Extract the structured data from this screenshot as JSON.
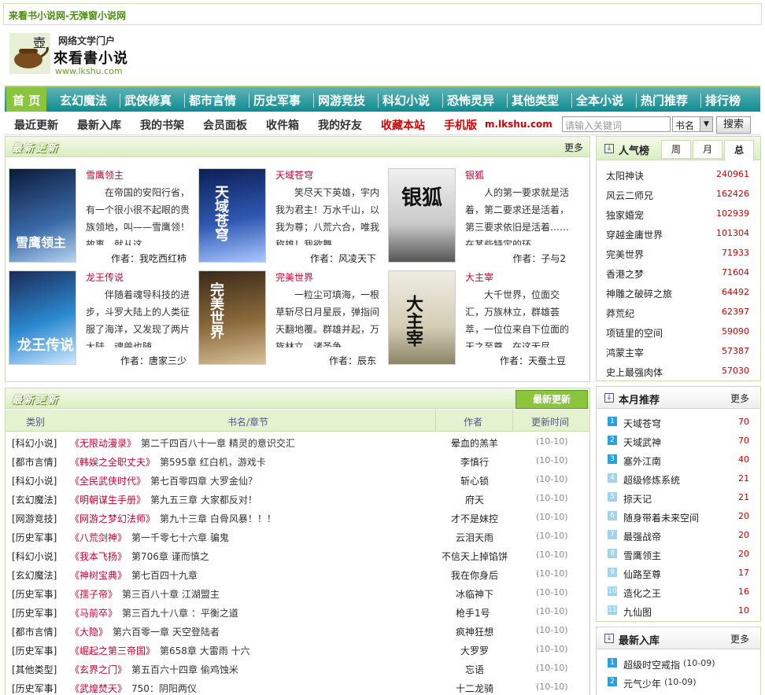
{
  "site_title": "来看书小说网-无弹窗小说网",
  "logo": {
    "tagline": "网络文学门户",
    "name": "來看書小说",
    "url": "www.lkshu.com"
  },
  "main_nav": [
    "首 页",
    "玄幻魔法",
    "武侠修真",
    "都市言情",
    "历史军事",
    "网游竞技",
    "科幻小说",
    "恐怖灵异",
    "其他类型",
    "全本小说",
    "热门推荐",
    "排行榜"
  ],
  "sub_nav": [
    "最近更新",
    "最新入库",
    "我的书架",
    "会员面板",
    "收件箱",
    "我的好友",
    "收藏本站",
    "手机版"
  ],
  "mobile_domain": "m.lkshu.com",
  "search": {
    "placeholder": "请输入关键词",
    "type": "书名",
    "button": "搜索"
  },
  "latest_panel": {
    "title": "最新更新",
    "more": "更多"
  },
  "featured_books": [
    {
      "name": "雪鹰领主",
      "desc": "在帝国的安阳行省，有一个很小很不起眼的贵族领地，叫——雪鹰领！故事，就从这",
      "author": "作者：我吃西红柿",
      "cover_text": "雪鹰领主"
    },
    {
      "name": "天域苍穹",
      "desc": "笑尽天下英雄，宇内我为君主！万水千山，以我为尊；八荒六合，唯我称雄！我欲舞",
      "author": "作者：风凌天下",
      "cover_text": "天域苍穹"
    },
    {
      "name": "银狐",
      "desc": "人的第一要求就是活着，第二要求还是活着，第三要求依旧是活着……在某些特定的环",
      "author": "作者：子与2",
      "cover_text": "银狐"
    },
    {
      "name": "龙王传说",
      "desc": "伴随着魂导科技的进步，斗罗大陆上的人类征服了海洋，又发现了两片大陆。魂兽也随",
      "author": "作者：唐家三少",
      "cover_text": "龙王传说"
    },
    {
      "name": "完美世界",
      "desc": "一粒尘可填海，一根草斩尽日月星辰，弹指间天翻地覆。群雄并起，万族林立，诸圣争",
      "author": "作者：辰东",
      "cover_text": "完美世界"
    },
    {
      "name": "大主宰",
      "desc": "大千世界，位面交汇，万族林立，群雄荟萃，一位位来自下位面的天之至尊，在这无尽",
      "author": "作者：天蚕土豆",
      "cover_text": "大主宰"
    }
  ],
  "update_panel": {
    "title": "最新更新",
    "tab": "最新更新",
    "headers": [
      "类别",
      "书名/章节",
      "作者",
      "更新时间"
    ]
  },
  "update_rows": [
    {
      "cat": "[科幻小说]",
      "book": "《无限动漫录》",
      "chapter": "第二千四百八十一章 精灵的意识交汇",
      "author": "晕血的羔羊",
      "time": "(10-10)"
    },
    {
      "cat": "[都市言情]",
      "book": "《韩娱之全职丈夫》",
      "chapter": "第595章 红白机，游戏卡",
      "author": "李慎行",
      "time": "(10-10)"
    },
    {
      "cat": "[科幻小说]",
      "book": "《全民武侠时代》",
      "chapter": "第七百零四章 大罗金仙？",
      "author": "斩心锁",
      "time": "(10-10)"
    },
    {
      "cat": "[玄幻魔法]",
      "book": "《明朝谋生手册》",
      "chapter": "第九五三章 大家都反对！",
      "author": "府天",
      "time": "(10-10)"
    },
    {
      "cat": "[网游竞技]",
      "book": "《网游之梦幻法师》",
      "chapter": "第九十三章 白骨风暴！！！",
      "author": "才不是妹控",
      "time": "(10-10)"
    },
    {
      "cat": "[历史军事]",
      "book": "《八荒剑神》",
      "chapter": "第一千零七十六章 骗鬼",
      "author": "云泪天雨",
      "time": "(10-10)"
    },
    {
      "cat": "[科幻小说]",
      "book": "《我本飞扬》",
      "chapter": "第706章 谨而慎之",
      "author": "不信天上掉馅饼",
      "time": "(10-10)"
    },
    {
      "cat": "[玄幻魔法]",
      "book": "《神树宝典》",
      "chapter": "第七百四十九章",
      "author": "我在你身后",
      "time": "(10-10)"
    },
    {
      "cat": "[历史军事]",
      "book": "《孺子帝》",
      "chapter": "第三百八十章 江湖盟主",
      "author": "冰临神下",
      "time": "(10-10)"
    },
    {
      "cat": "[历史军事]",
      "book": "《马前卒》",
      "chapter": "第三百九十八章 ：平衡之道",
      "author": "枪手1号",
      "time": "(10-10)"
    },
    {
      "cat": "[都市言情]",
      "book": "《大隐》",
      "chapter": "第六百零一章 天空登陆者",
      "author": "疯神狂想",
      "time": "(10-10)"
    },
    {
      "cat": "[历史军事]",
      "book": "《崛起之第三帝国》",
      "chapter": "第658章 大雷雨 十六",
      "author": "大罗罗",
      "time": "(10-10)"
    },
    {
      "cat": "[其他类型]",
      "book": "《玄界之门》",
      "chapter": "第五百六十四章 偷鸡蚀米",
      "author": "忘语",
      "time": "(10-10)"
    },
    {
      "cat": "[历史军事]",
      "book": "《武煌焚天》",
      "chapter": "750：阴阳两仪",
      "author": "十二龙骑",
      "time": "(10-10)"
    }
  ],
  "popular_panel": {
    "title": "人气榜",
    "tabs": [
      "周",
      "月",
      "总"
    ]
  },
  "popular": [
    {
      "name": "太阳神诀",
      "value": "240961"
    },
    {
      "name": "风云二师兄",
      "value": "162426"
    },
    {
      "name": "独家婚宠",
      "value": "102939"
    },
    {
      "name": "穿越金庸世界",
      "value": "101304"
    },
    {
      "name": "完美世界",
      "value": "71933"
    },
    {
      "name": "香港之梦",
      "value": "71604"
    },
    {
      "name": "神雕之破碎之旅",
      "value": "64492"
    },
    {
      "name": "莽荒纪",
      "value": "62397"
    },
    {
      "name": "项链里的空间",
      "value": "59090"
    },
    {
      "name": "鸿蒙主宰",
      "value": "57387"
    },
    {
      "name": "史上最强肉体",
      "value": "57030"
    }
  ],
  "monthly_panel": {
    "title": "本月推荐",
    "more": "更多"
  },
  "monthly": [
    {
      "n": "1",
      "name": "天域苍穹",
      "value": "70"
    },
    {
      "n": "2",
      "name": "天域武神",
      "value": "70"
    },
    {
      "n": "3",
      "name": "塞外江南",
      "value": "40"
    },
    {
      "n": "4",
      "name": "超级修炼系统",
      "value": "21"
    },
    {
      "n": "5",
      "name": "掠天记",
      "value": "21"
    },
    {
      "n": "6",
      "name": "随身带着未来空间",
      "value": "20"
    },
    {
      "n": "7",
      "name": "最强战帝",
      "value": "20"
    },
    {
      "n": "8",
      "name": "雪鹰领主",
      "value": "20"
    },
    {
      "n": "9",
      "name": "仙路至尊",
      "value": "17"
    },
    {
      "n": "10",
      "name": "造化之王",
      "value": "16"
    },
    {
      "n": "11",
      "name": "九仙图",
      "value": "10"
    }
  ],
  "newest_panel": {
    "title": "最新入库",
    "more": "更多"
  },
  "newest": [
    {
      "n": "1",
      "name": "超级时空戒指",
      "date": "(10-09)"
    },
    {
      "n": "2",
      "name": "元气少年",
      "date": "(10-09)"
    }
  ],
  "colors": {
    "nav": "#1a9096",
    "accent_green": "#8bc43d",
    "link_orange": "#c03"
  }
}
